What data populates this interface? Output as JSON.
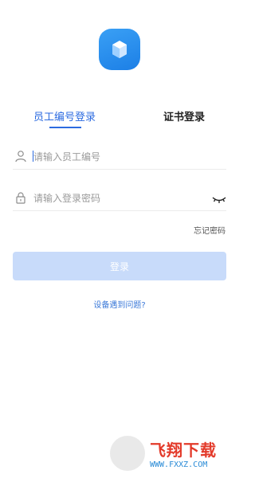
{
  "app": {
    "logo": "app-logo-icon"
  },
  "tabs": [
    {
      "label": "员工编号登录",
      "active": true
    },
    {
      "label": "证书登录",
      "active": false
    }
  ],
  "form": {
    "employee_id": {
      "value": "",
      "placeholder": "请输入员工编号",
      "icon": "user-icon"
    },
    "password": {
      "value": "",
      "placeholder": "请输入登录密码",
      "icon": "lock-icon",
      "toggle_icon": "eye-closed-icon"
    }
  },
  "forgot_label": "忘记密码",
  "login_label": "登录",
  "help_label": "设备遇到问题?",
  "watermark": {
    "title": "飞翔下载",
    "url": "WWW.FXXZ.COM"
  },
  "colors": {
    "accent": "#2c6be0",
    "button_disabled": "#c8dbfa",
    "logo": "#1c7fe6"
  }
}
